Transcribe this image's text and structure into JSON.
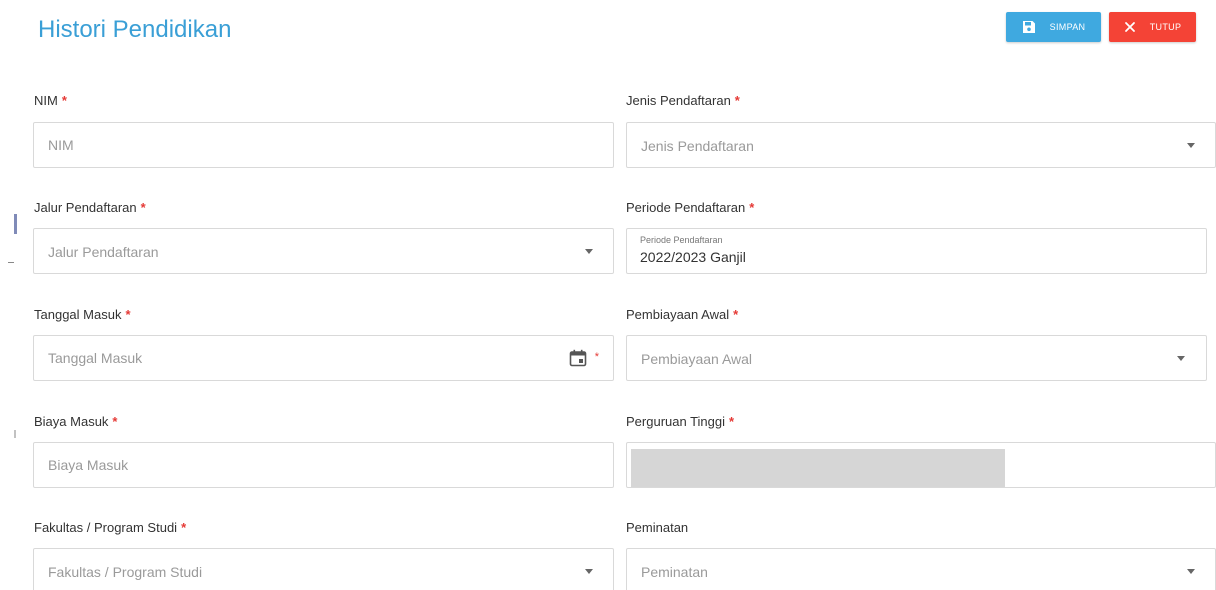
{
  "header": {
    "title": "Histori Pendidikan",
    "save_label": "SIMPAN",
    "close_label": "TUTUP"
  },
  "colors": {
    "title": "#3a9fd6",
    "save_button": "#3fa9e0",
    "close_button": "#f44336",
    "required_marker": "#e53935"
  },
  "required_marker": "*",
  "form": {
    "nim": {
      "label": "NIM",
      "placeholder": "NIM"
    },
    "jenis_pendaftaran": {
      "label": "Jenis Pendaftaran",
      "placeholder": "Jenis Pendaftaran"
    },
    "jalur_pendaftaran": {
      "label": "Jalur Pendaftaran",
      "placeholder": "Jalur Pendaftaran"
    },
    "periode_pendaftaran": {
      "label": "Periode Pendaftaran",
      "inner_label": "Periode Pendaftaran",
      "value": "2022/2023 Ganjil"
    },
    "tanggal_masuk": {
      "label": "Tanggal Masuk",
      "placeholder": "Tanggal Masuk",
      "icon": "calendar-icon"
    },
    "pembiayaan_awal": {
      "label": "Pembiayaan Awal",
      "placeholder": "Pembiayaan Awal"
    },
    "biaya_masuk": {
      "label": "Biaya Masuk",
      "placeholder": "Biaya Masuk"
    },
    "perguruan_tinggi": {
      "label": "Perguruan Tinggi"
    },
    "fakultas_program_studi": {
      "label": "Fakultas / Program Studi",
      "placeholder": "Fakultas / Program Studi"
    },
    "peminatan": {
      "label": "Peminatan",
      "placeholder": "Peminatan"
    }
  }
}
